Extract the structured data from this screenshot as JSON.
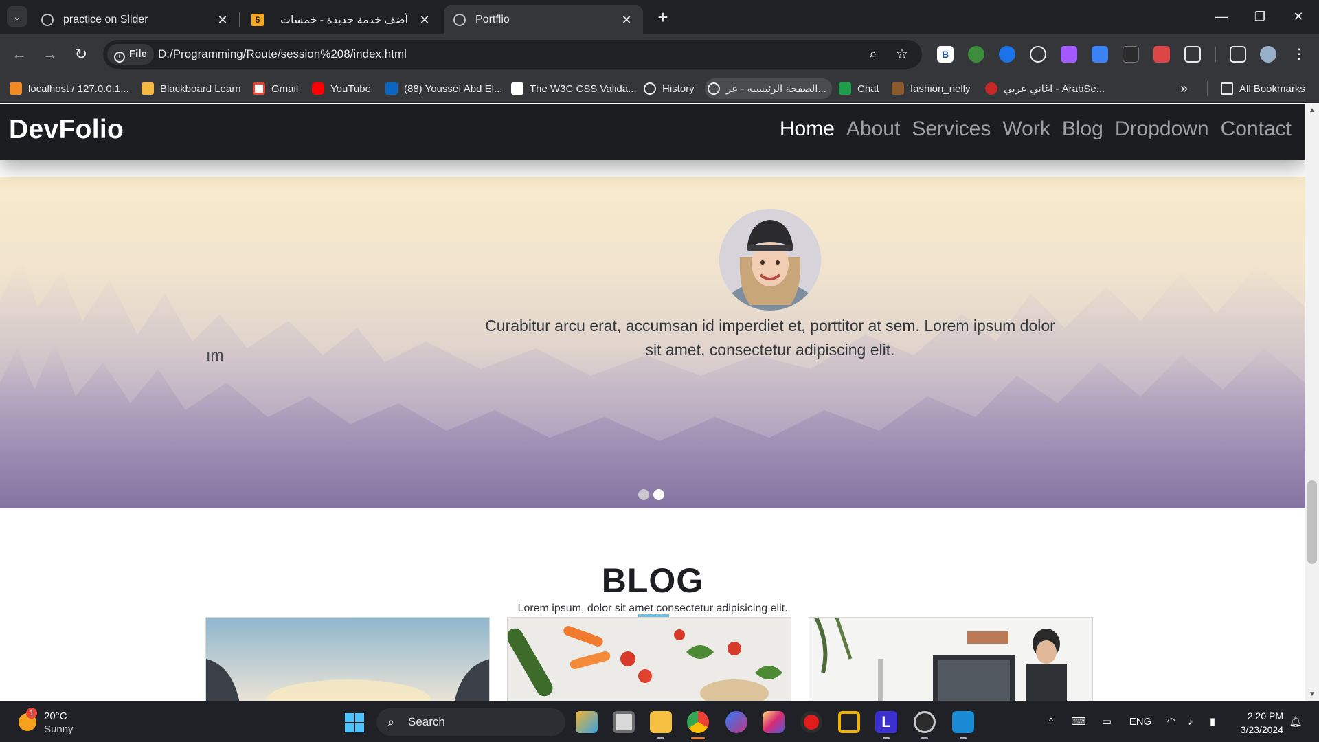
{
  "browser": {
    "tabs": [
      {
        "title": "practice on Slider",
        "close": "✕"
      },
      {
        "title": "أضف خدمة جديدة - خمسات",
        "close": "✕",
        "icon_text": "5"
      },
      {
        "title": "Portflio",
        "close": "✕"
      }
    ],
    "new_tab": "+",
    "window_controls": {
      "minimize": "—",
      "restore": "❐",
      "close": "✕"
    },
    "address": {
      "chip": "File",
      "url": "D:/Programming/Route/session%208/index.html"
    },
    "bookmarks": [
      {
        "label": "localhost / 127.0.0.1..."
      },
      {
        "label": "Blackboard Learn"
      },
      {
        "label": "Gmail"
      },
      {
        "label": "YouTube"
      },
      {
        "label": "(88) Youssef Abd El..."
      },
      {
        "label": "The W3C CSS Valida..."
      },
      {
        "label": "History"
      },
      {
        "label": "الصفحة الرئيسيه - عر..."
      },
      {
        "label": "Chat"
      },
      {
        "label": "fashion_nelly"
      },
      {
        "label": "اغاني عربي - ArabSe..."
      }
    ],
    "bookmarks_more": "»",
    "all_bookmarks": "All Bookmarks"
  },
  "site": {
    "logo": "DevFolio",
    "nav": [
      "Home",
      "About",
      "Services",
      "Work",
      "Blog",
      "Dropdown",
      "Contact"
    ],
    "active_nav": "Home",
    "testimonial": {
      "quote": "Curabitur arcu erat, accumsan id imperdiet et, porttitor at sem. Lorem ipsum dolor sit amet, consectetur adipiscing elit.",
      "side_fragment": "ım",
      "slide_count": 2,
      "active_slide": 2
    },
    "blog": {
      "title": "BLOG",
      "subtitle": "Lorem ipsum, dolor sit amet consectetur adipisicing elit."
    }
  },
  "taskbar": {
    "weather": {
      "temp": "20°C",
      "desc": "Sunny",
      "badge": "1"
    },
    "search_placeholder": "Search",
    "language": "ENG",
    "time": "2:20 PM",
    "date": "3/23/2024"
  },
  "colors": {
    "nav_bg": "#1c1d20",
    "accent": "#6fc0df",
    "chrome_dark": "#202124",
    "chrome_mid": "#35363a"
  }
}
